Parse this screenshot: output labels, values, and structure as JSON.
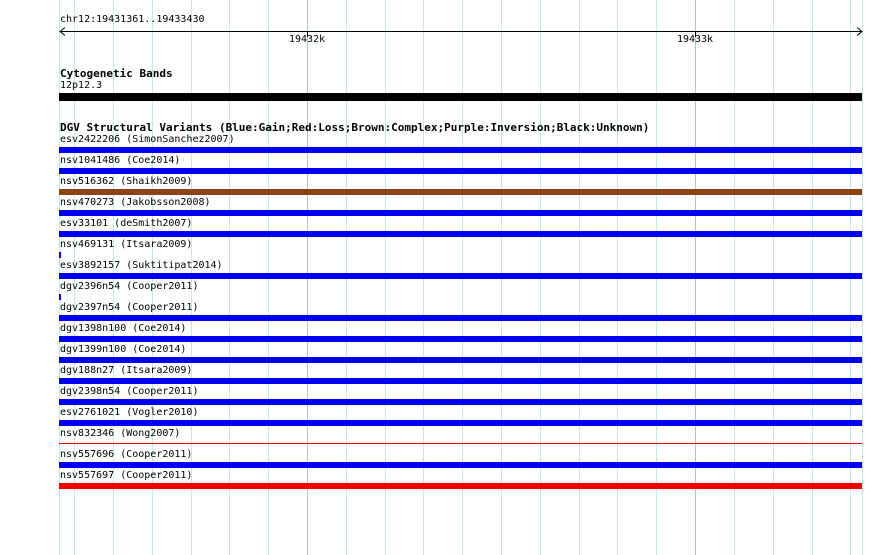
{
  "region": {
    "label": "chr12:19431361..19433430",
    "start": 19431361,
    "end": 19433430
  },
  "ruler": {
    "ticks": [
      {
        "label": "19432k",
        "position": 19432000
      },
      {
        "label": "19433k",
        "position": 19433000
      }
    ]
  },
  "cytoband_track": {
    "title": "Cytogenetic Bands",
    "band": "12p12.3",
    "color": "#000000"
  },
  "dgv_track": {
    "title": "DGV Structural Variants (Blue:Gain;Red:Loss;Brown:Complex;Purple:Inversion;Black:Unknown)",
    "features": [
      {
        "label": "esv2422206 (SimonSanchez2007)",
        "type": "gain",
        "extent": "full"
      },
      {
        "label": "nsv1041486 (Coe2014)",
        "type": "gain",
        "extent": "full"
      },
      {
        "label": "nsv516362 (Shaikh2009)",
        "type": "complex",
        "extent": "full"
      },
      {
        "label": "nsv470273 (Jakobsson2008)",
        "type": "gain",
        "extent": "full"
      },
      {
        "label": "esv33101 (deSmith2007)",
        "type": "gain",
        "extent": "full"
      },
      {
        "label": "nsv469131 (Itsara2009)",
        "type": "gain",
        "extent": "edge"
      },
      {
        "label": "esv3892157 (Suktitipat2014)",
        "type": "gain",
        "extent": "full"
      },
      {
        "label": "dgv2396n54 (Cooper2011)",
        "type": "gain",
        "extent": "edge"
      },
      {
        "label": "dgv2397n54 (Cooper2011)",
        "type": "gain",
        "extent": "full"
      },
      {
        "label": "dgv1398n100 (Coe2014)",
        "type": "gain",
        "extent": "full"
      },
      {
        "label": "dgv1399n100 (Coe2014)",
        "type": "gain",
        "extent": "full"
      },
      {
        "label": "dgv188n27 (Itsara2009)",
        "type": "gain",
        "extent": "full"
      },
      {
        "label": "dgv2398n54 (Cooper2011)",
        "type": "gain",
        "extent": "full"
      },
      {
        "label": "esv2761021 (Vogler2010)",
        "type": "gain",
        "extent": "full"
      },
      {
        "label": "nsv832346 (Wong2007)",
        "type": "loss",
        "extent": "full",
        "style": "thin"
      },
      {
        "label": "nsv557696 (Cooper2011)",
        "type": "gain",
        "extent": "full"
      },
      {
        "label": "nsv557697 (Cooper2011)",
        "type": "loss",
        "extent": "full"
      }
    ]
  },
  "colors": {
    "gain": "#0000ee",
    "loss": "#ee0000",
    "complex": "#8b4513",
    "inversion": "#800080",
    "unknown": "#000000",
    "gridline": "#c8e4ef"
  }
}
